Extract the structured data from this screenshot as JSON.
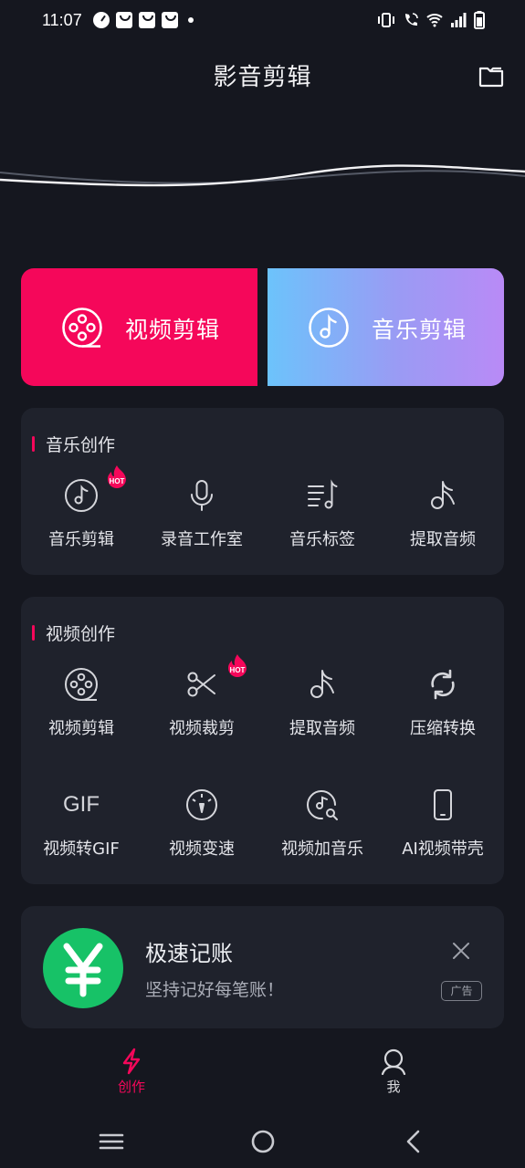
{
  "status_bar": {
    "time": "11:07",
    "left_icons": [
      "speedometer-icon",
      "shopping-bag-icon",
      "shopping-bag-icon",
      "shopping-bag-icon",
      "dot-icon"
    ],
    "right_icons": [
      "vibrate-icon",
      "wifi-calling-icon",
      "wifi-icon",
      "signal-icon",
      "battery-icon"
    ]
  },
  "header": {
    "title": "影音剪辑",
    "right_icon": "folder-icon"
  },
  "hero": {
    "video_edit": {
      "label": "视频剪辑",
      "icon": "film-reel-icon",
      "color": "#f5075a"
    },
    "music_edit": {
      "label": "音乐剪辑",
      "icon": "music-note-icon",
      "gradient": [
        "#6cc3fb",
        "#b98af6"
      ]
    }
  },
  "music_section": {
    "title": "音乐创作",
    "items": [
      {
        "label": "音乐剪辑",
        "icon": "music-disc-icon",
        "badge": "HOT"
      },
      {
        "label": "录音工作室",
        "icon": "microphone-icon"
      },
      {
        "label": "音乐标签",
        "icon": "music-list-icon"
      },
      {
        "label": "提取音频",
        "icon": "tiktok-note-icon"
      }
    ]
  },
  "video_section": {
    "title": "视频创作",
    "items": [
      {
        "label": "视频剪辑",
        "icon": "film-reel-icon"
      },
      {
        "label": "视频裁剪",
        "icon": "scissors-icon",
        "badge": "HOT"
      },
      {
        "label": "提取音频",
        "icon": "tiktok-note-icon"
      },
      {
        "label": "压缩转换",
        "icon": "refresh-icon"
      },
      {
        "label": "视频转GIF",
        "icon": "gif-icon",
        "icon_text": "GIF"
      },
      {
        "label": "视频变速",
        "icon": "speedometer-icon"
      },
      {
        "label": "视频加音乐",
        "icon": "music-search-icon"
      },
      {
        "label": "AI视频带壳",
        "icon": "phone-icon"
      }
    ]
  },
  "ad": {
    "title": "极速记账",
    "subtitle": "坚持记好每笔账！",
    "badge": "广告",
    "logo_icon": "yen-icon",
    "logo_color": "#17c267"
  },
  "bottom_tabs": [
    {
      "label": "创作",
      "icon": "lightning-icon",
      "active": true
    },
    {
      "label": "我",
      "icon": "user-icon",
      "active": false
    }
  ],
  "colors": {
    "background": "#15171f",
    "panel": "#1f222c",
    "accent": "#f5075a"
  }
}
